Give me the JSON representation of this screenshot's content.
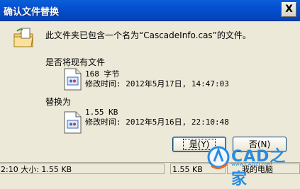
{
  "dialog": {
    "title": "确认文件替换",
    "close_label": "X",
    "message": "此文件夹已包含一个名为“CascadeInfo.cas”的文件。",
    "question": "是否将现有文件",
    "existing": {
      "size": "168 字节",
      "modified": "修改时间: 2012年5月17日, 14:47:03"
    },
    "replace_label": "替换为",
    "replacement": {
      "size": "1.55 KB",
      "modified": "修改时间: 2012年5月16日, 22:10:48"
    },
    "yes_label": "是(Y)",
    "no_label": "否(N)"
  },
  "statusbar": {
    "left": "2:10 大小: 1.55 KB",
    "size": "1.55 KB",
    "location": "我的电脑"
  },
  "watermark": {
    "text": "CAD之家",
    "url": "www.CADZJ.com"
  },
  "colors": {
    "title_bar": "#0450cf",
    "dialog_bg": "#ece9d8",
    "button_border": "#003c74"
  }
}
